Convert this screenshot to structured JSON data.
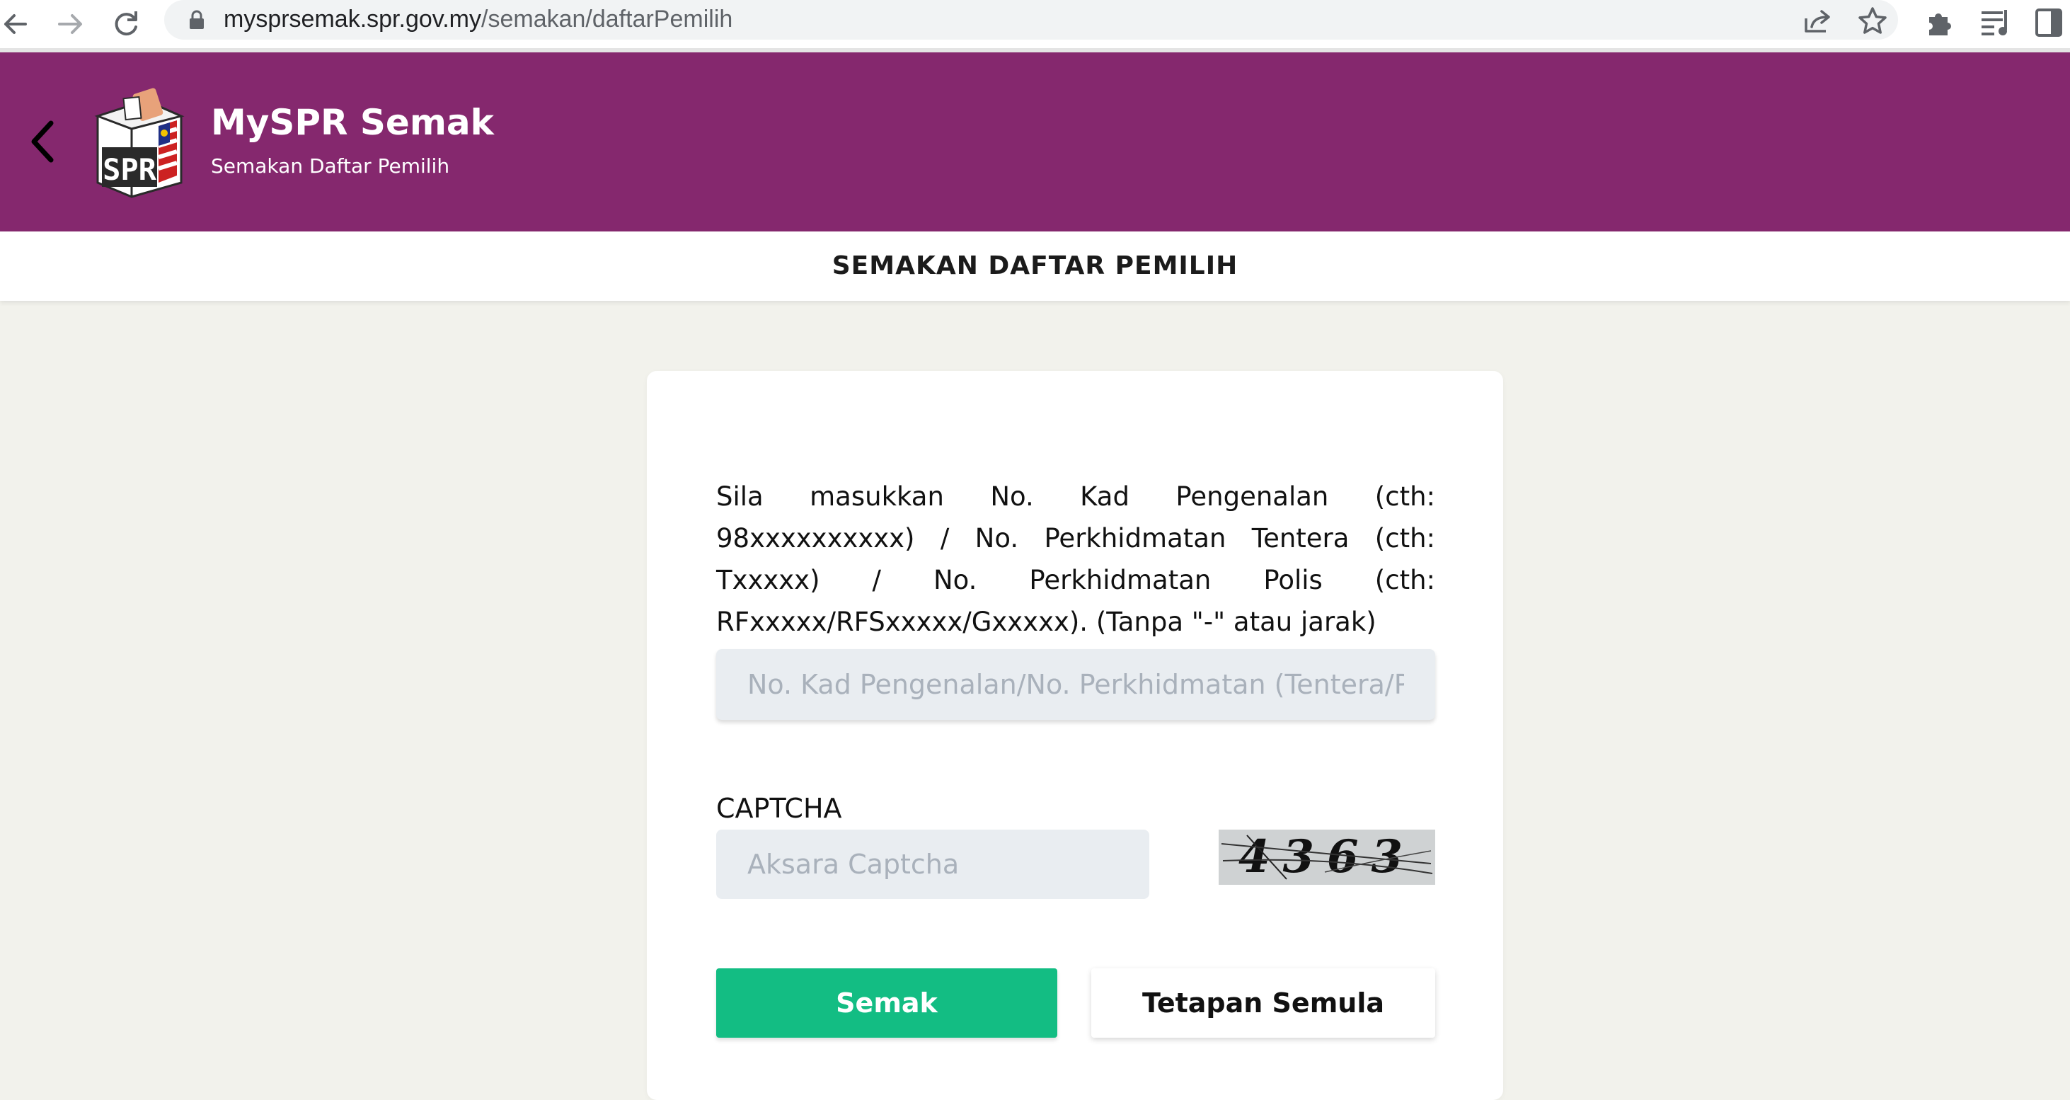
{
  "browser": {
    "url_host": "mysprsemak.spr.gov.my",
    "url_path": "/semakan/daftarPemilih",
    "icons": [
      "back-arrow-icon",
      "forward-arrow-icon",
      "reload-icon",
      "lock-icon",
      "share-icon",
      "star-icon",
      "extensions-icon",
      "reading-list-icon",
      "side-panel-icon"
    ]
  },
  "header": {
    "title": "MySPR Semak",
    "subtitle": "Semakan Daftar Pemilih",
    "logo_text": "SPR",
    "background_color": "#85286e"
  },
  "page": {
    "title": "SEMAKAN DAFTAR PEMILIH"
  },
  "form": {
    "instruction": "Sila masukkan No. Kad Pengenalan (cth: 98xxxxxxxxxx) / No. Perkhidmatan Tentera (cth: Txxxxx) / No. Perkhidmatan Polis (cth: RFxxxxx/RFSxxxxx/Gxxxxx). (Tanpa \"-\" atau jarak)",
    "id_placeholder": "No. Kad Pengenalan/No. Perkhidmatan (Tentera/Polis)",
    "captcha_label": "CAPTCHA",
    "captcha_placeholder": "Aksara Captcha",
    "captcha_code": "4363",
    "submit_label": "Semak",
    "reset_label": "Tetapan Semula",
    "submit_color": "#13bd83"
  }
}
